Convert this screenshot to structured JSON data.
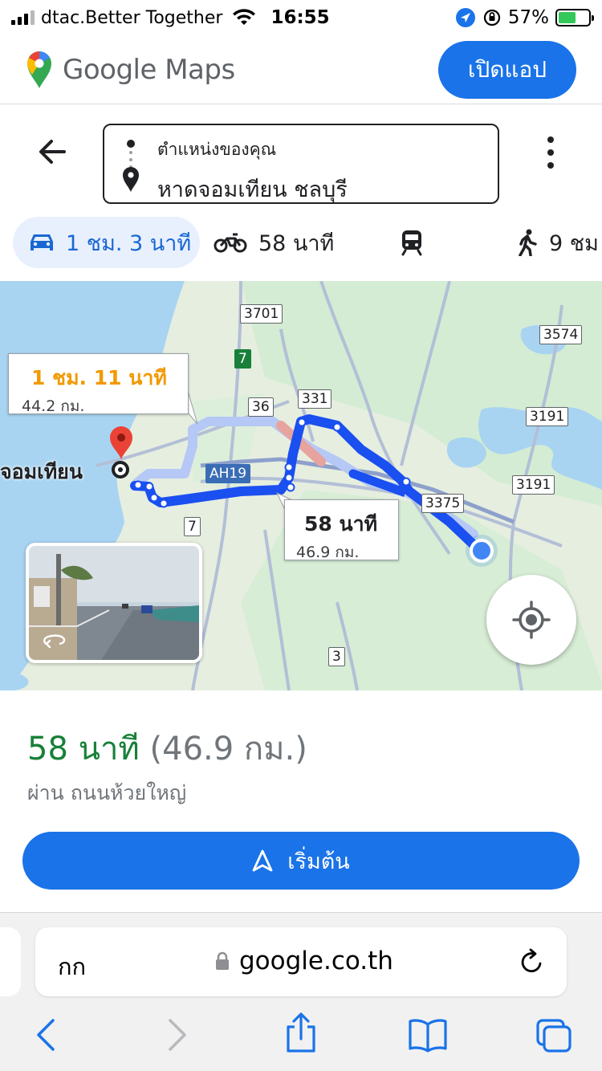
{
  "status_bar": {
    "carrier": "dtac.Better Together",
    "time": "16:55",
    "battery": "57%"
  },
  "header": {
    "logo_text": "Google Maps",
    "open_app_label": "เปิดแอป"
  },
  "directions": {
    "origin": "ตำแหน่งของคุณ",
    "destination": "หาดจอมเทียน ชลบุรี"
  },
  "modes": {
    "drive": "1 ชม. 3 นาที",
    "motorcycle": "58 นาที",
    "walk": "9 ชม"
  },
  "map": {
    "callout_alt_time": "1 ชม. 11 นาที",
    "callout_alt_dist": "44.2 กม.",
    "callout_main_time": "58 นาที",
    "callout_main_dist": "46.9 กม.",
    "place_label": "จอมเทียน",
    "shields": {
      "r3701": "3701",
      "r7top": "7",
      "r36": "36",
      "r331": "331",
      "r3574": "3574",
      "r3191a": "3191",
      "r3191b": "3191",
      "ah19": "AH19",
      "r3375": "3375",
      "r7low": "7",
      "r3": "3"
    },
    "colors": {
      "route_main": "#1a4ff0",
      "route_alt": "#a9c0f5",
      "water": "#a8d4f2",
      "land": "#e6eee0"
    }
  },
  "summary": {
    "duration": "58 นาที",
    "distance": "(46.9 กม.)",
    "via": "ผ่าน ถนนห้วยใหญ่",
    "start_label": "เริ่มต้น"
  },
  "safari": {
    "aa_label": "กก",
    "url": "google.co.th"
  }
}
